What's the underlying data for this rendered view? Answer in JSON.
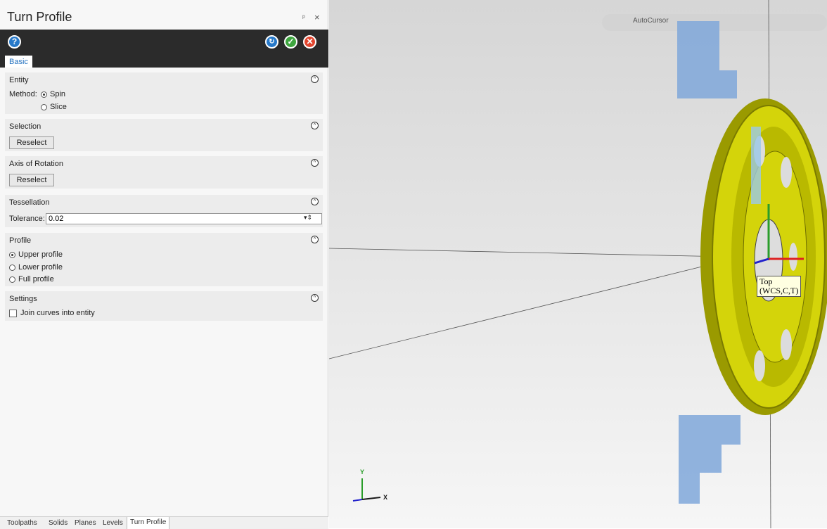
{
  "panel": {
    "title": "Turn Profile",
    "pin_glyph": "ᵖ",
    "close_glyph": "×",
    "tab": "Basic",
    "entity": {
      "title": "Entity",
      "method_label": "Method:",
      "options": [
        "Spin",
        "Slice"
      ],
      "selected": "Spin"
    },
    "selection": {
      "title": "Selection",
      "button": "Reselect"
    },
    "axis": {
      "title": "Axis of Rotation",
      "button": "Reselect"
    },
    "tessellation": {
      "title": "Tessellation",
      "tolerance_label": "Tolerance:",
      "tolerance_value": "0.02"
    },
    "profile": {
      "title": "Profile",
      "options": [
        "Upper profile",
        "Lower profile",
        "Full profile"
      ],
      "selected": "Upper profile"
    },
    "settings": {
      "title": "Settings",
      "join_label": "Join curves into entity",
      "join_checked": false
    }
  },
  "bottom_tabs": [
    "Toolpaths",
    "Solids",
    "Planes",
    "Levels",
    "Turn Profile"
  ],
  "viewport": {
    "toolbar_label": "AutoCursor",
    "tooltip_line1": "Top",
    "tooltip_line2": "(WCS,C,T)",
    "axis_y": "Y",
    "axis_x": "X"
  },
  "colors": {
    "accent": "#1f6fbf",
    "ok": "#3ea53f",
    "cancel": "#e2452e",
    "gear": "#d4d40a",
    "stock": "#7fa7d9"
  },
  "icons": [
    "help-icon",
    "apply-icon",
    "ok-icon",
    "cancel-icon",
    "pin-icon",
    "close-icon",
    "collapse-icon"
  ]
}
